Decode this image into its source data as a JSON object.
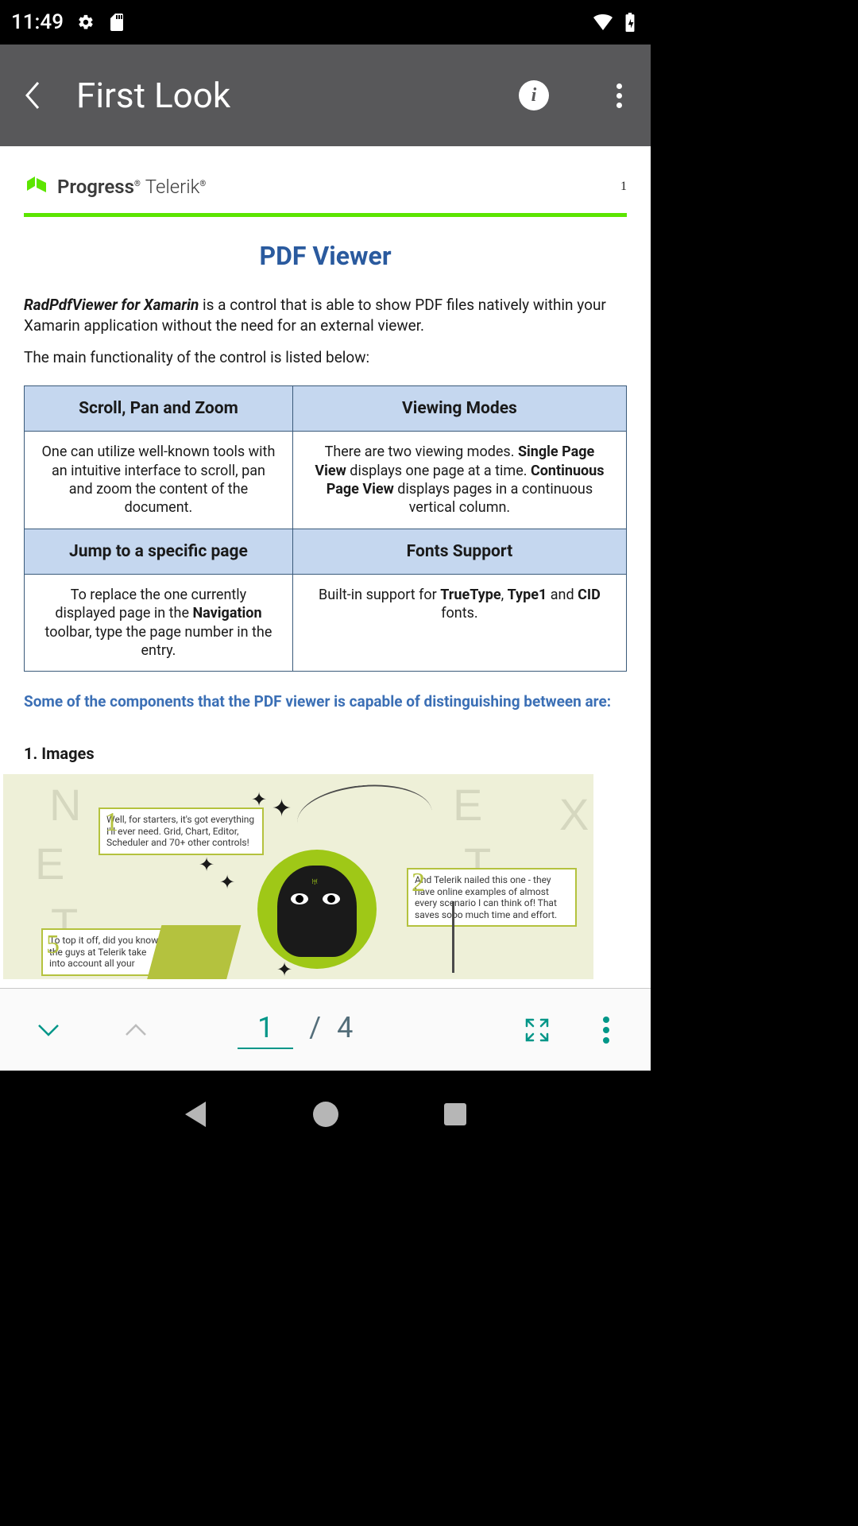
{
  "status": {
    "time": "11:49"
  },
  "appbar": {
    "title": "First Look"
  },
  "document": {
    "brand_primary": "Progress",
    "brand_secondary": "Telerik",
    "page_number_top": "1",
    "title": "PDF Viewer",
    "lead_strong": "RadPdfViewer for Xamarin",
    "lead_rest": " is a control that is able to show PDF files natively within your Xamarin application without the need for an external viewer.",
    "sub_intro": "The main functionality of the control is listed below:",
    "table": {
      "h1": "Scroll, Pan and Zoom",
      "h2": "Viewing Modes",
      "h3": "Jump to a specific page",
      "h4": "Fonts Support",
      "c1": "One can utilize well-known tools with an intuitive interface to scroll, pan and zoom the content of the document.",
      "c2_pre": "There are two viewing modes. ",
      "c2_b1": "Single Page View",
      "c2_mid": " displays one page at a time. ",
      "c2_b2": "Continuous Page View",
      "c2_end": " displays pages in a continuous vertical column.",
      "c3_pre": "To replace the one currently displayed page in the ",
      "c3_b": "Navigation",
      "c3_end": " toolbar, type the page number in the entry.",
      "c4_pre": "Built-in support for ",
      "c4_b1": "TrueType",
      "c4_sep1": ", ",
      "c4_b2": "Type1",
      "c4_sep2": " and ",
      "c4_b3": "CID",
      "c4_end": " fonts."
    },
    "components_line": "Some of the components that the PDF viewer is capable of distinguishing between are:",
    "images_heading": "1. Images",
    "illus": {
      "bubble1": "Well, for starters, it's got everything I'll ever need. Grid, Chart, Editor, Scheduler and 70+ other controls!",
      "bubble2": "And Telerik nailed this one - they have online examples of almost every scenario I can think of! That saves sooo much time and effort.",
      "bubble5": "To top it off, did you know the guys at Telerik take into account all your"
    }
  },
  "toolbar": {
    "current_page": "1",
    "separator": "/",
    "total_pages": "4"
  }
}
